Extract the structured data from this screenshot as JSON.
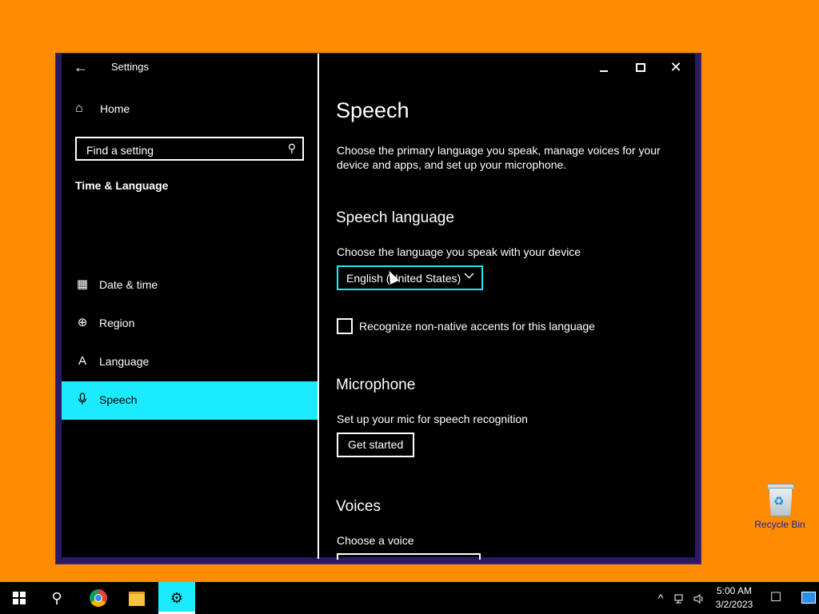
{
  "window": {
    "title": "Settings",
    "back": "←",
    "close": "✕"
  },
  "sidebar": {
    "home": {
      "icon": "home-icon",
      "glyph": "⌂",
      "label": "Home"
    },
    "search": {
      "placeholder": "Find a setting",
      "icon": "search-icon",
      "glyph": "⚲"
    },
    "section": "Time & Language",
    "items": [
      {
        "icon": "calendar-clock-icon",
        "glyph": "▦",
        "label": "Date & time",
        "active": false
      },
      {
        "icon": "globe-icon",
        "glyph": "⊕",
        "label": "Region",
        "active": false
      },
      {
        "icon": "language-icon",
        "glyph": "A",
        "label": "Language",
        "active": false
      },
      {
        "icon": "microphone-icon",
        "glyph": "🎙",
        "label": "Speech",
        "active": true
      }
    ]
  },
  "content": {
    "title": "Speech",
    "description": "Choose the primary language you speak, manage voices for your device and apps, and set up your microphone.",
    "speech_language": {
      "heading": "Speech language",
      "prompt": "Choose the language you speak with your device",
      "selected": "English (United States)",
      "checkbox_label": "Recognize non-native accents for this language",
      "checkbox_checked": false
    },
    "microphone": {
      "heading": "Microphone",
      "prompt": "Set up your mic for speech recognition",
      "button": "Get started"
    },
    "voices": {
      "heading": "Voices",
      "prompt": "Choose a voice"
    }
  },
  "desktop": {
    "recycle_bin_label": "Recycle Bin"
  },
  "taskbar": {
    "time": "5:00 AM",
    "date": "3/2/2023",
    "search_glyph": "⚲",
    "chevron_glyph": "^",
    "settings_glyph": "⚙",
    "notif_glyph": "☐"
  },
  "colors": {
    "accent": "#1aebff",
    "desktop": "#ff8c00",
    "window_bg": "#000000"
  }
}
